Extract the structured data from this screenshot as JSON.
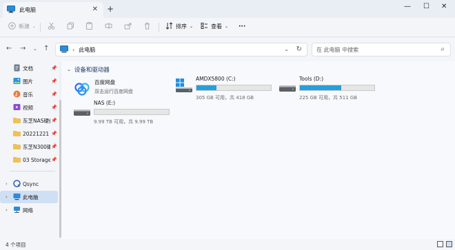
{
  "window": {
    "tab_title": "此电脑",
    "close_tab_glyph": "✕",
    "new_tab_glyph": "+",
    "minimize_glyph": "—",
    "maximize_glyph": "☐",
    "close_glyph": "✕"
  },
  "toolbar": {
    "new_label": "新建",
    "sort_label": "排序",
    "view_label": "查看",
    "more_glyph": "···"
  },
  "address": {
    "location": "此电脑",
    "search_placeholder": "在 此电脑 中搜索"
  },
  "sidebar": {
    "quick_access": [
      {
        "label": "文档",
        "icon": "document-icon"
      },
      {
        "label": "图片",
        "icon": "pictures-icon"
      },
      {
        "label": "音乐",
        "icon": "music-icon"
      },
      {
        "label": "视频",
        "icon": "video-icon"
      },
      {
        "label": "东芝NAS硬盘",
        "icon": "folder-icon"
      },
      {
        "label": "20221221 R",
        "icon": "folder-icon"
      },
      {
        "label": "东芝N300硬盘",
        "icon": "folder-icon"
      },
      {
        "label": "03 Storage",
        "icon": "folder-icon"
      }
    ],
    "tree": [
      {
        "label": "Qsync",
        "icon": "qsync-icon"
      },
      {
        "label": "此电脑",
        "icon": "this-pc-icon"
      },
      {
        "label": "网络",
        "icon": "network-icon"
      }
    ]
  },
  "main": {
    "group_title": "设备和驱动器",
    "drives": [
      {
        "name": "百度网盘",
        "subtitle": "双击运行百度网盘"
      },
      {
        "name": "AMDX5800 (C:)",
        "info": "305 GB 可用，共 418 GB",
        "used_fraction": 0.27
      },
      {
        "name": "Tools (D:)",
        "info": "225 GB 可用，共 511 GB",
        "used_fraction": 0.56
      },
      {
        "name": "NAS (E:)",
        "info": "9.99 TB 可用，共 9.99 TB",
        "used_fraction": 0.0
      }
    ]
  },
  "status": {
    "item_count": "4 个项目"
  },
  "colors": {
    "accent": "#26a0da",
    "folder": "#f2c14e",
    "selected": "#cfdff4"
  }
}
